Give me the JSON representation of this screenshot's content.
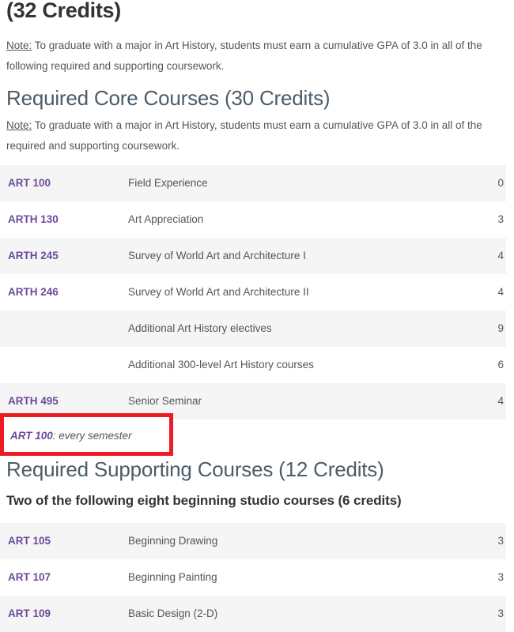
{
  "page": {
    "truncated_top_heading": "(32 Credits)",
    "background_color": "#ffffff",
    "link_color": "#6c4a9c",
    "heading_color": "#4c5c68",
    "body_text_color": "#555555",
    "row_stripe_color": "#f5f5f5",
    "annotation_color": "#ed1c24"
  },
  "notes": {
    "label": "Note:",
    "first": " To graduate with a major in Art History, students must earn a cumulative GPA of 3.0 in all of the following required and supporting coursework.",
    "second": " To graduate with a major in Art History, students must earn a cumulative GPA of 3.0 in all of the required and supporting coursework."
  },
  "sections": {
    "core_heading": "Required Core Courses (30 Credits)",
    "supporting_heading": "Required Supporting Courses (12 Credits)",
    "supporting_subheading": "Two of the following eight beginning studio courses (6 credits)"
  },
  "core_courses": [
    {
      "code": "ART 100",
      "title": "Field Experience",
      "credits": "0"
    },
    {
      "code": "ARTH 130",
      "title": "Art Appreciation",
      "credits": "3"
    },
    {
      "code": "ARTH 245",
      "title": "Survey of World Art and Architecture I",
      "credits": "4"
    },
    {
      "code": "ARTH 246",
      "title": "Survey of World Art and Architecture II",
      "credits": "4"
    },
    {
      "code": "",
      "title": "Additional Art History electives",
      "credits": "9"
    },
    {
      "code": "",
      "title": "Additional 300-level Art History courses",
      "credits": "6"
    },
    {
      "code": "ARTH 495",
      "title": "Senior Seminar",
      "credits": "4"
    }
  ],
  "supporting_courses": [
    {
      "code": "ART 105",
      "title": "Beginning Drawing",
      "credits": "3"
    },
    {
      "code": "ART 107",
      "title": "Beginning Painting",
      "credits": "3"
    },
    {
      "code": "ART 109",
      "title": "Basic Design (2-D)",
      "credits": "3"
    }
  ],
  "annotation": {
    "code": "ART 100",
    "rest": ": every semester"
  }
}
